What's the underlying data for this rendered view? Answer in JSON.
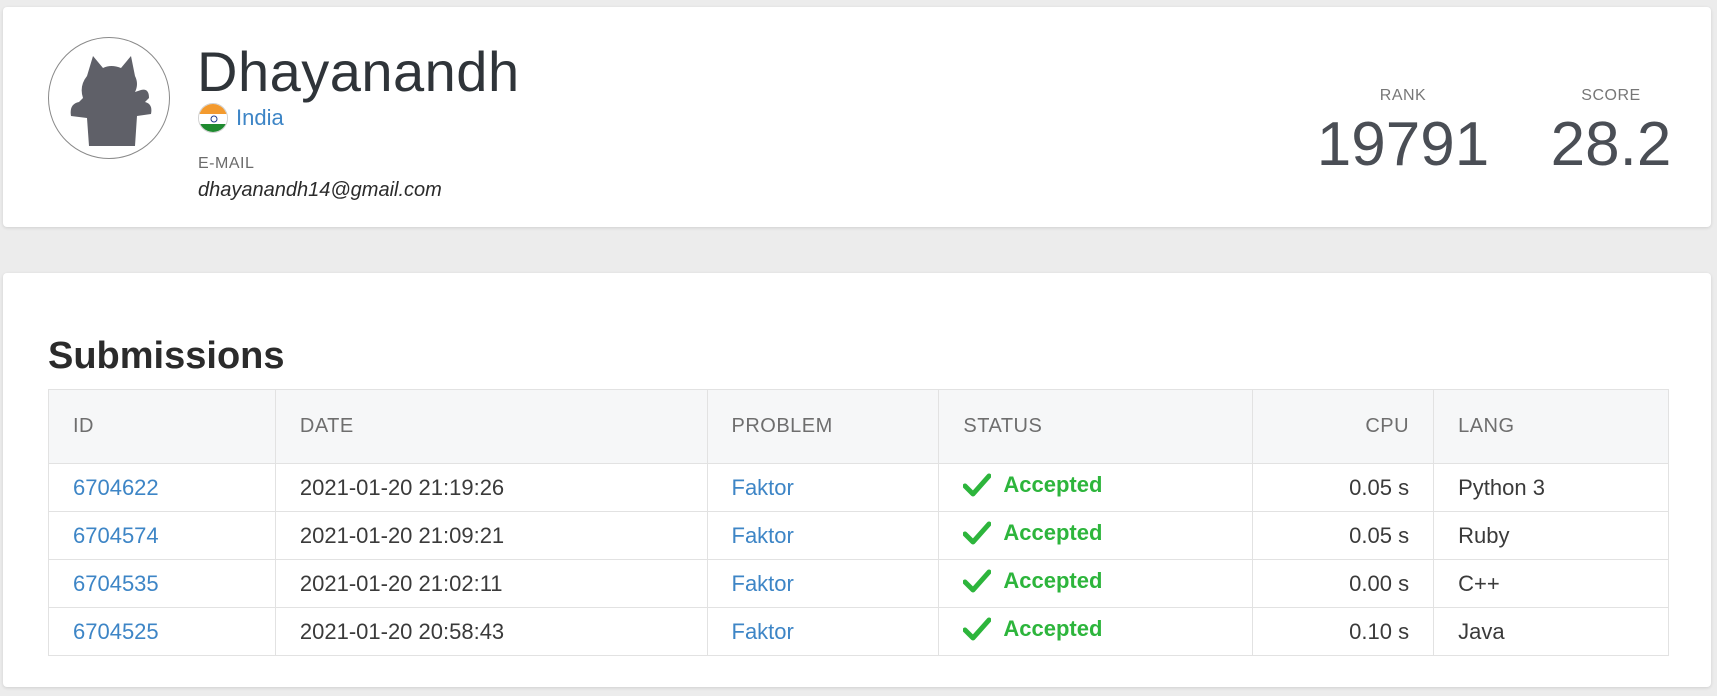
{
  "profile": {
    "name": "Dhayanandh",
    "country": "India",
    "email_label": "E-MAIL",
    "email": "dhayanandh14@gmail.com",
    "rank_label": "RANK",
    "rank": "19791",
    "score_label": "SCORE",
    "score": "28.2"
  },
  "submissions": {
    "title": "Submissions",
    "columns": {
      "id": "ID",
      "date": "DATE",
      "problem": "PROBLEM",
      "status": "STATUS",
      "cpu": "CPU",
      "lang": "LANG"
    },
    "rows": [
      {
        "id": "6704622",
        "date": "2021-01-20 21:19:26",
        "problem": "Faktor",
        "status": "Accepted",
        "cpu": "0.05 s",
        "lang": "Python 3"
      },
      {
        "id": "6704574",
        "date": "2021-01-20 21:09:21",
        "problem": "Faktor",
        "status": "Accepted",
        "cpu": "0.05 s",
        "lang": "Ruby"
      },
      {
        "id": "6704535",
        "date": "2021-01-20 21:02:11",
        "problem": "Faktor",
        "status": "Accepted",
        "cpu": "0.00 s",
        "lang": "C++"
      },
      {
        "id": "6704525",
        "date": "2021-01-20 20:58:43",
        "problem": "Faktor",
        "status": "Accepted",
        "cpu": "0.10 s",
        "lang": "Java"
      }
    ]
  },
  "colors": {
    "link": "#3d85c6",
    "accepted": "#2db53c",
    "background": "#ececec"
  },
  "icons": {
    "avatar": "cat-silhouette-icon",
    "flag": "india-flag-icon",
    "status": "check-icon"
  }
}
